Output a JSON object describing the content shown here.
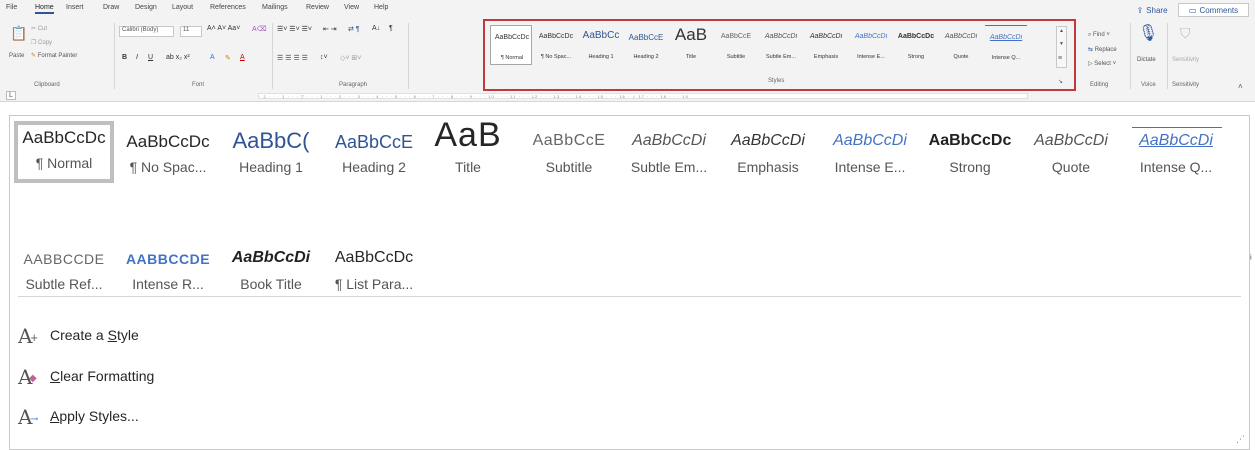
{
  "ribbon": {
    "tabs": [
      "File",
      "Home",
      "Insert",
      "Draw",
      "Design",
      "Layout",
      "References",
      "Mailings",
      "Review",
      "View",
      "Help"
    ],
    "active_tab": "Home",
    "share_label": "Share",
    "comments_label": "Comments",
    "clipboard": {
      "cut": "Cut",
      "copy": "Copy",
      "paste": "Paste",
      "format_painter": "Format Painter",
      "label": "Clipboard"
    },
    "font": {
      "family": "Calibri (Body)",
      "size": "11",
      "label": "Font"
    },
    "paragraph_label": "Paragraph",
    "styles_label": "Styles",
    "editing": {
      "find": "Find",
      "replace": "Replace",
      "select": "Select",
      "label": "Editing"
    },
    "voice": {
      "dictate": "Dictate",
      "label": "Voice"
    },
    "sensitivity": {
      "button": "Sensitivity",
      "label": "Sensitivity"
    },
    "ruler_text": "· 2 · · · 1 · · · ▽ · · · 1 · · · 2 · · · 3 · · · 4 · · · 5 · · · 6 · · · 7 · · · 8 · · · 9 · · · 10 · · · 11 · · · 12 · · · 13 · · · 14 · · · 15 · · · 16 · △ 17 · · · 18 · · · 19",
    "tab_stop": "L"
  },
  "styles_small": [
    {
      "sample": "AaBbCcDc",
      "name": "¶ Normal"
    },
    {
      "sample": "AaBbCcDc",
      "name": "¶ No Spac..."
    },
    {
      "sample": "AaBbCc",
      "name": "Heading 1"
    },
    {
      "sample": "AaBbCcE",
      "name": "Heading 2"
    },
    {
      "sample": "AaB",
      "name": "Title"
    },
    {
      "sample": "AaBbCcE",
      "name": "Subtitle"
    },
    {
      "sample": "AaBbCcDi",
      "name": "Subtle Em..."
    },
    {
      "sample": "AaBbCcDi",
      "name": "Emphasis"
    },
    {
      "sample": "AaBbCcDi",
      "name": "Intense E..."
    },
    {
      "sample": "AaBbCcDc",
      "name": "Strong"
    },
    {
      "sample": "AaBbCcDi",
      "name": "Quote"
    },
    {
      "sample": "AaBbCcDi",
      "name": "Intense Q..."
    }
  ],
  "gallery": {
    "row1": [
      {
        "sample": "AaBbCcDc",
        "name": "¶ Normal"
      },
      {
        "sample": "AaBbCcDc",
        "name": "¶ No Spac..."
      },
      {
        "sample": "AaBbC(",
        "name": "Heading 1"
      },
      {
        "sample": "AaBbCcE",
        "name": "Heading 2"
      },
      {
        "sample": "AaB",
        "name": "Title"
      },
      {
        "sample": "AaBbCcE",
        "name": "Subtitle"
      },
      {
        "sample": "AaBbCcDi",
        "name": "Subtle Em..."
      },
      {
        "sample": "AaBbCcDi",
        "name": "Emphasis"
      },
      {
        "sample": "AaBbCcDi",
        "name": "Intense E..."
      },
      {
        "sample": "AaBbCcDc",
        "name": "Strong"
      },
      {
        "sample": "AaBbCcDi",
        "name": "Quote"
      },
      {
        "sample": "AaBbCcDi",
        "name": "Intense Q..."
      }
    ],
    "row2": [
      {
        "sample": "AABBCCDE",
        "name": "Subtle Ref..."
      },
      {
        "sample": "AABBCCDE",
        "name": "Intense R..."
      },
      {
        "sample": "AaBbCcDi",
        "name": "Book Title"
      },
      {
        "sample": "AaBbCcDc",
        "name": "¶ List Para..."
      }
    ],
    "menu": {
      "create": {
        "pre": "Create a ",
        "u": "S",
        "post": "tyle"
      },
      "clear": {
        "pre": "",
        "u": "C",
        "post": "lear Formatting"
      },
      "apply": {
        "pre": "",
        "u": "A",
        "post": "pply Styles..."
      }
    },
    "edge_mark": "ᵢ",
    "grip": "⋰"
  },
  "colors": {
    "accent": "#2b579a",
    "highlight": "#c0393b",
    "heading_blue": "#2f5496",
    "intense_blue": "#4472c4"
  }
}
